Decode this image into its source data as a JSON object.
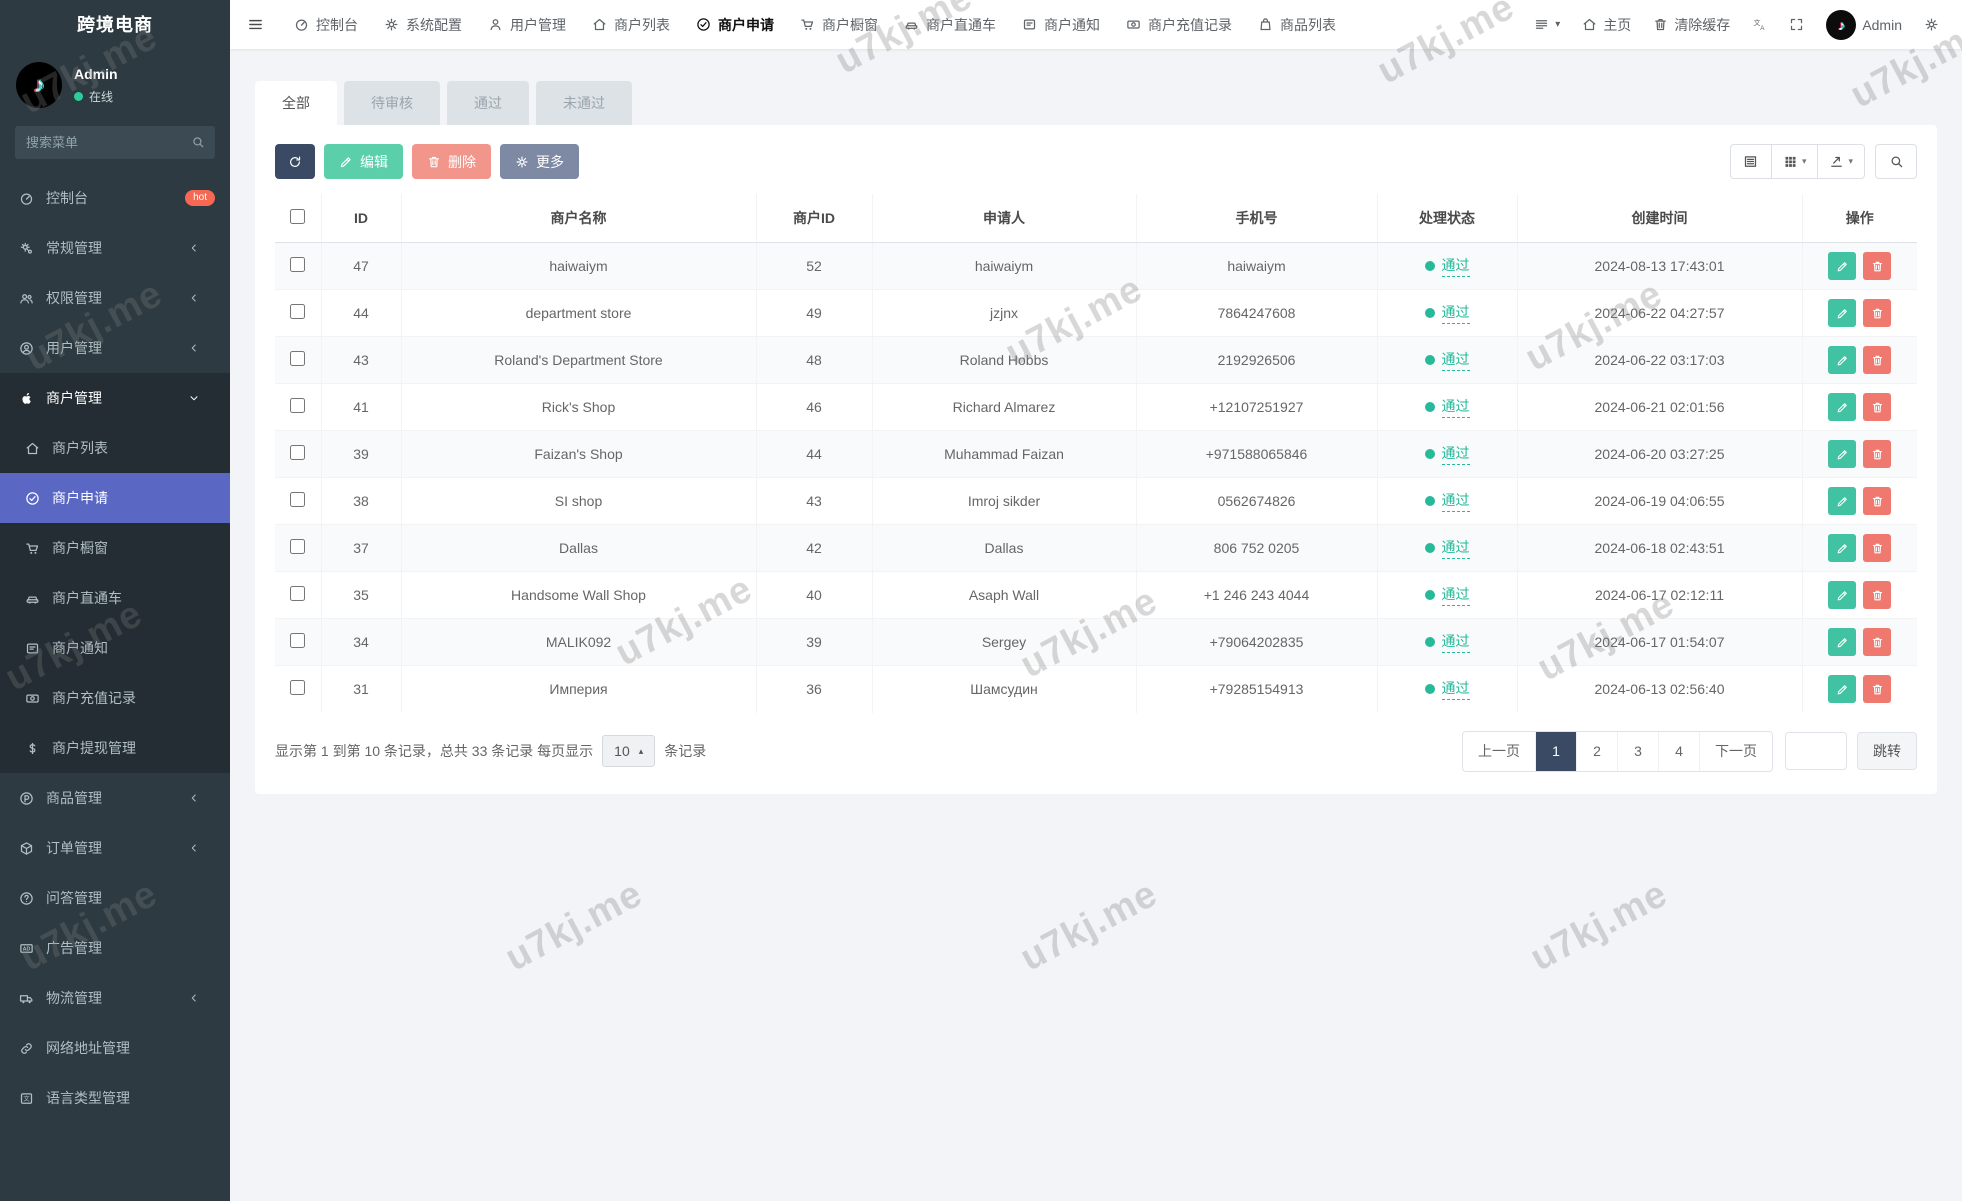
{
  "app": {
    "brand": "跨境电商",
    "watermark": "u7kj.me"
  },
  "user": {
    "name": "Admin",
    "status": "在线"
  },
  "sidebar": {
    "search_placeholder": "搜索菜单",
    "items": [
      {
        "label": "控制台",
        "icon": "gauge-icon",
        "badge": "hot"
      },
      {
        "label": "常规管理",
        "icon": "gears-icon",
        "chevron": "left"
      },
      {
        "label": "权限管理",
        "icon": "users-icon",
        "chevron": "left"
      },
      {
        "label": "用户管理",
        "icon": "user-circle-icon",
        "chevron": "left"
      },
      {
        "label": "商户管理",
        "icon": "apple-icon",
        "chevron": "down",
        "section": true,
        "open": true
      },
      {
        "label": "商户列表",
        "icon": "home-icon",
        "sub": true
      },
      {
        "label": "商户申请",
        "icon": "check-circle-icon",
        "sub": true,
        "active": true
      },
      {
        "label": "商户橱窗",
        "icon": "cart-icon",
        "sub": true
      },
      {
        "label": "商户直通车",
        "icon": "car-icon",
        "sub": true
      },
      {
        "label": "商户通知",
        "icon": "notice-icon",
        "sub": true
      },
      {
        "label": "商户充值记录",
        "icon": "money-icon",
        "sub": true
      },
      {
        "label": "商户提现管理",
        "icon": "dollar-icon",
        "sub": true
      },
      {
        "label": "商品管理",
        "icon": "product-icon",
        "chevron": "left"
      },
      {
        "label": "订单管理",
        "icon": "order-icon",
        "chevron": "left"
      },
      {
        "label": "问答管理",
        "icon": "question-icon"
      },
      {
        "label": "广告管理",
        "icon": "ad-icon"
      },
      {
        "label": "物流管理",
        "icon": "truck-icon",
        "chevron": "left"
      },
      {
        "label": "网络地址管理",
        "icon": "link-icon"
      },
      {
        "label": "语言类型管理",
        "icon": "language-icon"
      }
    ]
  },
  "topnav": {
    "items": [
      {
        "label": "控制台",
        "icon": "gauge-icon"
      },
      {
        "label": "系统配置",
        "icon": "gear-icon"
      },
      {
        "label": "用户管理",
        "icon": "user-icon"
      },
      {
        "label": "商户列表",
        "icon": "home-icon"
      },
      {
        "label": "商户申请",
        "icon": "check-circle-icon",
        "active": true
      },
      {
        "label": "商户橱窗",
        "icon": "cart-icon"
      },
      {
        "label": "商户直通车",
        "icon": "car-icon"
      },
      {
        "label": "商户通知",
        "icon": "notice-icon"
      },
      {
        "label": "商户充值记录",
        "icon": "money-icon"
      },
      {
        "label": "商品列表",
        "icon": "bag-icon"
      }
    ],
    "right": {
      "home_label": "主页",
      "clear_cache_label": "清除缓存",
      "user_name": "Admin"
    }
  },
  "tabs": [
    {
      "label": "全部",
      "active": true
    },
    {
      "label": "待审核"
    },
    {
      "label": "通过"
    },
    {
      "label": "未通过"
    }
  ],
  "toolbar": {
    "edit_label": "编辑",
    "delete_label": "删除",
    "more_label": "更多"
  },
  "table": {
    "headers": [
      "ID",
      "商户名称",
      "商户ID",
      "申请人",
      "手机号",
      "处理状态",
      "创建时间",
      "操作"
    ],
    "rows": [
      {
        "id": "47",
        "name": "haiwaiym",
        "merchant_id": "52",
        "applicant": "haiwaiym",
        "phone": "haiwaiym",
        "status": "通过",
        "created": "2024-08-13 17:43:01"
      },
      {
        "id": "44",
        "name": "department store",
        "merchant_id": "49",
        "applicant": "jzjnx",
        "phone": "7864247608",
        "status": "通过",
        "created": "2024-06-22 04:27:57"
      },
      {
        "id": "43",
        "name": "Roland's Department Store",
        "merchant_id": "48",
        "applicant": "Roland Hobbs",
        "phone": "2192926506",
        "status": "通过",
        "created": "2024-06-22 03:17:03"
      },
      {
        "id": "41",
        "name": "Rick's Shop",
        "merchant_id": "46",
        "applicant": "Richard Almarez",
        "phone": "+12107251927",
        "status": "通过",
        "created": "2024-06-21 02:01:56"
      },
      {
        "id": "39",
        "name": "Faizan's Shop",
        "merchant_id": "44",
        "applicant": "Muhammad Faizan",
        "phone": "+971588065846",
        "status": "通过",
        "created": "2024-06-20 03:27:25"
      },
      {
        "id": "38",
        "name": "SI shop",
        "merchant_id": "43",
        "applicant": "Imroj sikder",
        "phone": "0562674826",
        "status": "通过",
        "created": "2024-06-19 04:06:55"
      },
      {
        "id": "37",
        "name": "Dallas",
        "merchant_id": "42",
        "applicant": "Dallas",
        "phone": "806 752 0205",
        "status": "通过",
        "created": "2024-06-18 02:43:51"
      },
      {
        "id": "35",
        "name": "Handsome Wall Shop",
        "merchant_id": "40",
        "applicant": "Asaph Wall",
        "phone": "+1 246 243 4044",
        "status": "通过",
        "created": "2024-06-17 02:12:11"
      },
      {
        "id": "34",
        "name": "MALIK092",
        "merchant_id": "39",
        "applicant": "Sergey",
        "phone": "+79064202835",
        "status": "通过",
        "created": "2024-06-17 01:54:07"
      },
      {
        "id": "31",
        "name": "Империя",
        "merchant_id": "36",
        "applicant": "Шамсудин",
        "phone": "+79285154913",
        "status": "通过",
        "created": "2024-06-13 02:56:40"
      }
    ]
  },
  "pagination": {
    "info_prefix": "显示第 1 到第 10 条记录，总共 33 条记录 每页显示",
    "page_size": "10",
    "info_suffix": "条记录",
    "prev": "上一页",
    "pages": [
      "1",
      "2",
      "3",
      "4"
    ],
    "active_page": "1",
    "next": "下一页",
    "jump": "跳转"
  },
  "colors": {
    "sidebar_bg": "#2d3a41",
    "sidebar_active": "#5a68c4",
    "status_green": "#26b99a",
    "btn_refresh": "#3b4a64",
    "btn_edit": "#5bceaa",
    "btn_delete": "#f2958b",
    "btn_more": "#7e89a4",
    "badge_hot": "#f56954"
  }
}
